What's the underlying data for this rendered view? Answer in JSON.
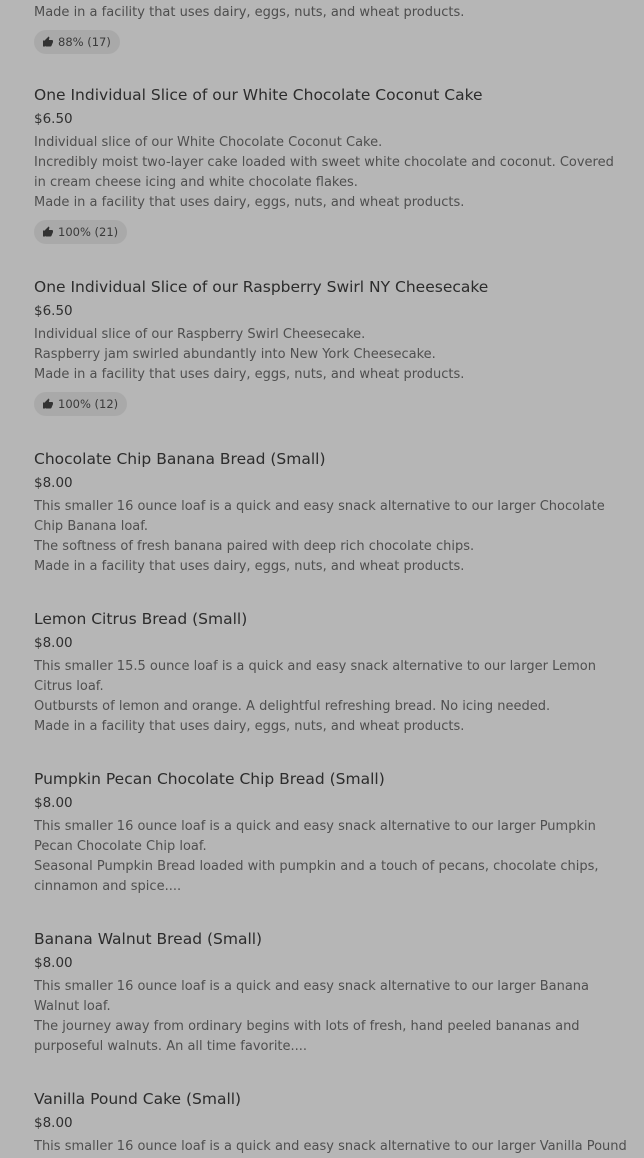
{
  "fragment": {
    "desc": "Made in a facility that uses dairy, eggs, nuts, and wheat products.",
    "rating": "88% (17)"
  },
  "items": [
    {
      "title": "One Individual Slice of our White Chocolate Coconut Cake",
      "price": "$6.50",
      "desc": [
        "Individual slice of our White Chocolate Coconut Cake.",
        "Incredibly moist two-layer cake loaded with sweet white chocolate and coconut. Covered in cream cheese icing and white chocolate flakes.",
        "Made in a facility that uses dairy, eggs, nuts, and wheat products."
      ],
      "rating": "100% (21)"
    },
    {
      "title": "One Individual Slice of our Raspberry Swirl NY Cheesecake",
      "price": "$6.50",
      "desc": [
        "Individual slice of our Raspberry Swirl Cheesecake.",
        "Raspberry jam swirled abundantly into New York Cheesecake.",
        "Made in a facility that uses dairy, eggs, nuts, and wheat products."
      ],
      "rating": "100% (12)"
    },
    {
      "title": "Chocolate Chip Banana Bread (Small)",
      "price": "$8.00",
      "desc": [
        "This smaller 16 ounce loaf is a quick and easy snack alternative to our larger Chocolate Chip Banana loaf.",
        "The softness of fresh banana paired with deep rich chocolate chips.",
        "Made in a facility that uses dairy, eggs, nuts, and wheat products."
      ]
    },
    {
      "title": "Lemon Citrus Bread (Small)",
      "price": "$8.00",
      "desc": [
        "This smaller 15.5 ounce loaf is a quick and easy snack alternative to our larger Lemon Citrus loaf.",
        "Outbursts of lemon and orange. A delightful refreshing bread. No icing needed.",
        "Made in a facility that uses dairy, eggs, nuts, and wheat products."
      ]
    },
    {
      "title": "Pumpkin Pecan Chocolate Chip Bread (Small)",
      "price": "$8.00",
      "desc": [
        "This smaller 16 ounce loaf is a quick and easy snack alternative to our larger Pumpkin Pecan Chocolate Chip loaf.",
        "Seasonal Pumpkin Bread loaded with pumpkin and a touch of pecans, chocolate chips, cinnamon and spice...."
      ]
    },
    {
      "title": "Banana Walnut Bread (Small)",
      "price": "$8.00",
      "desc": [
        "This smaller 16 ounce loaf is a quick and easy snack alternative to our larger Banana Walnut loaf.",
        "The journey away from ordinary begins with lots of fresh, hand peeled bananas and purposeful walnuts. An all time favorite...."
      ]
    },
    {
      "title": "Vanilla Pound Cake (Small)",
      "price": "$8.00",
      "desc": [
        "This smaller 16 ounce loaf is a quick and easy snack alternative to our larger Vanilla Pound"
      ]
    }
  ]
}
